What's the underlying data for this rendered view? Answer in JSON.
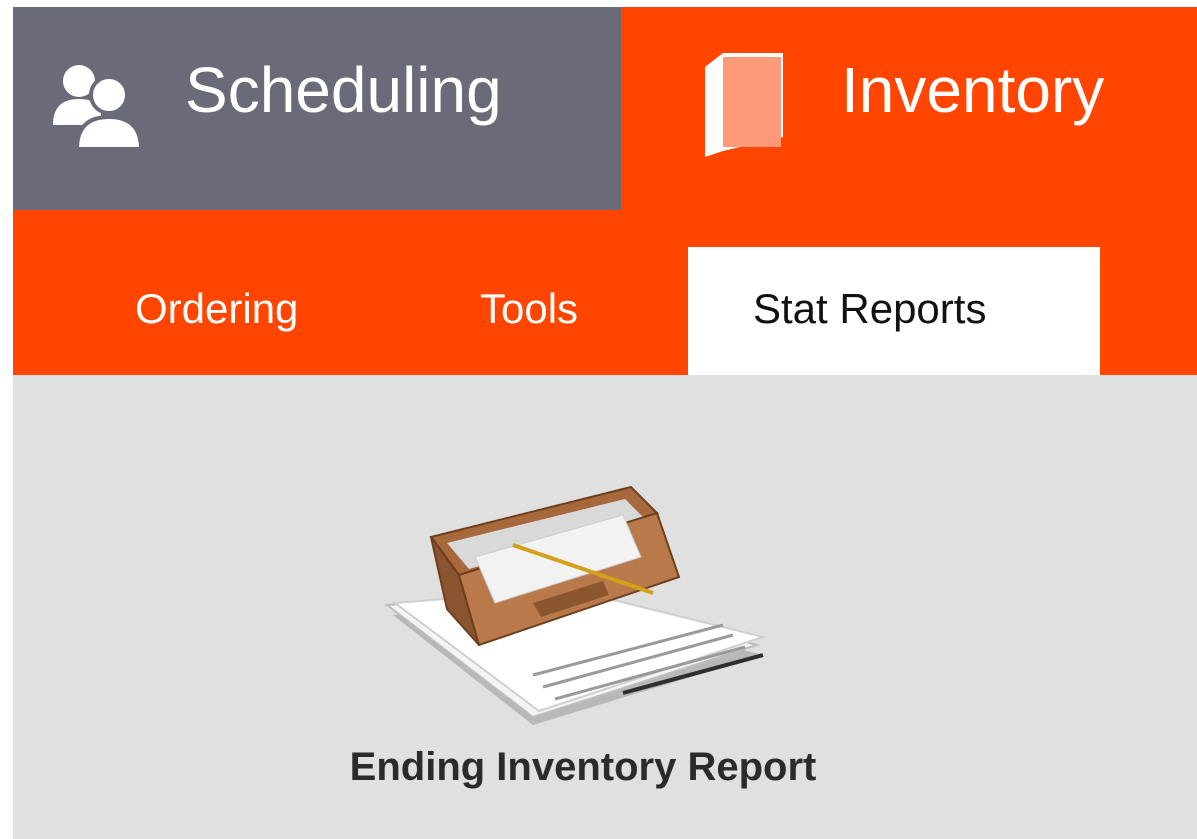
{
  "top_tabs": [
    {
      "label": "Scheduling",
      "icon": "users-icon",
      "active": false
    },
    {
      "label": "Inventory",
      "icon": "book-icon",
      "active": true
    }
  ],
  "sub_tabs": [
    {
      "label": "Ordering",
      "active": false
    },
    {
      "label": "Tools",
      "active": false
    },
    {
      "label": "Stat Reports",
      "active": true
    }
  ],
  "content": {
    "reports": [
      {
        "label": "Ending Inventory Report",
        "icon": "inbox-tray-icon"
      }
    ]
  },
  "colors": {
    "accent": "#ff4500",
    "inactive_tab": "#6b6a78",
    "content_bg": "#e0e0e0",
    "active_subtab_bg": "#ffffff"
  }
}
